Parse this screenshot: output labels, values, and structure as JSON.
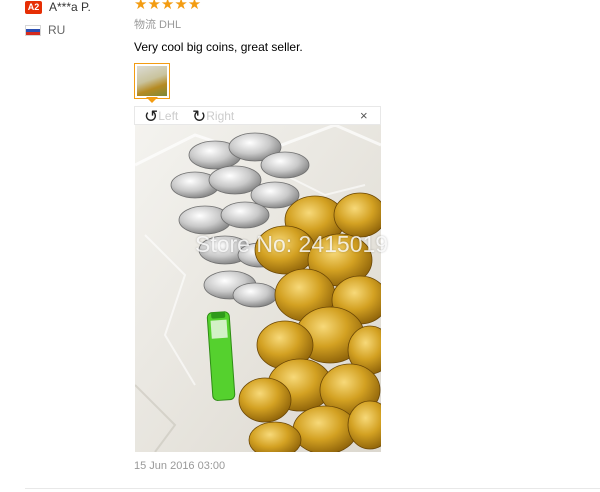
{
  "review": {
    "badge": "A2",
    "buyer_name": "A***a P.",
    "country_code": "RU",
    "flag_colors": [
      "#ffffff",
      "#2b4fb3",
      "#d52b1e"
    ],
    "stars": "★★★★★",
    "rating": 5,
    "star_color": "#f39c12",
    "shipping": "物流 DHL",
    "feedback_text": "Very cool big coins, great seller.",
    "viewer": {
      "rotate_left_label": "Left",
      "rotate_right_label": "Right",
      "close_glyph": "×"
    },
    "photo_watermark": "Store No: 2415019",
    "date": "15 Jun 2016 03:00"
  }
}
